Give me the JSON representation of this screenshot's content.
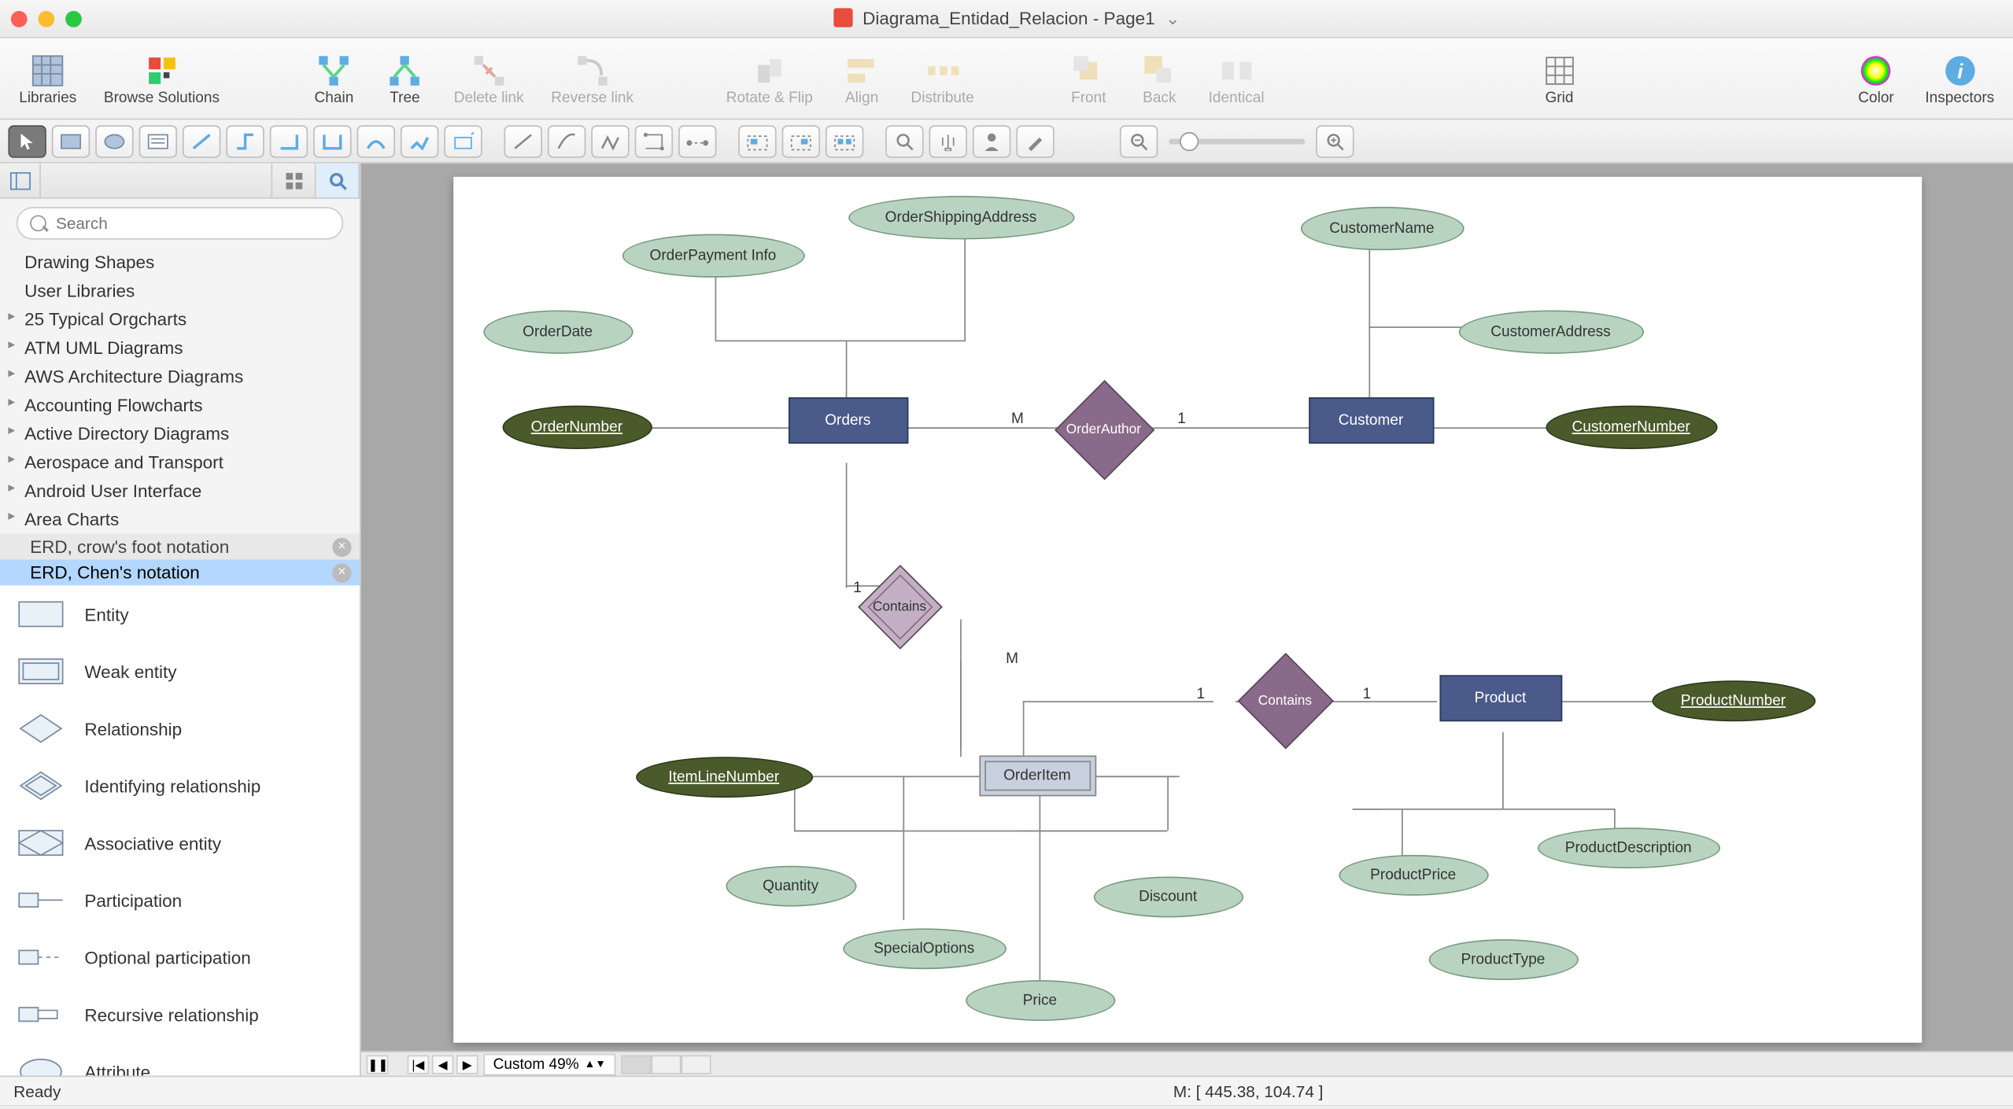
{
  "title": "Diagrama_Entidad_Relacion - Page1",
  "toolbar": {
    "libraries": "Libraries",
    "browse": "Browse Solutions",
    "chain": "Chain",
    "tree": "Tree",
    "delete_link": "Delete link",
    "reverse_link": "Reverse link",
    "rotate_flip": "Rotate & Flip",
    "align": "Align",
    "distribute": "Distribute",
    "front": "Front",
    "back": "Back",
    "identical": "Identical",
    "grid": "Grid",
    "color": "Color",
    "inspectors": "Inspectors"
  },
  "search_placeholder": "Search",
  "libraries": [
    {
      "label": "Drawing Shapes",
      "arrow": false
    },
    {
      "label": "User Libraries",
      "arrow": false
    },
    {
      "label": "25 Typical Orgcharts",
      "arrow": true
    },
    {
      "label": "ATM UML Diagrams",
      "arrow": true
    },
    {
      "label": "AWS Architecture Diagrams",
      "arrow": true
    },
    {
      "label": "Accounting Flowcharts",
      "arrow": true
    },
    {
      "label": "Active Directory Diagrams",
      "arrow": true
    },
    {
      "label": "Aerospace and Transport",
      "arrow": true
    },
    {
      "label": "Android User Interface",
      "arrow": true
    },
    {
      "label": "Area Charts",
      "arrow": true
    }
  ],
  "stencil_tabs": [
    {
      "label": "ERD, crow's foot notation",
      "active": false
    },
    {
      "label": "ERD, Chen's notation",
      "active": true
    }
  ],
  "stencils": [
    "Entity",
    "Weak entity",
    "Relationship",
    "Identifying relationship",
    "Associative entity",
    "Participation",
    "Optional participation",
    "Recursive relationship",
    "Attribute"
  ],
  "diagram": {
    "entities": {
      "orders": "Orders",
      "customer": "Customer",
      "product": "Product",
      "orderitem": "OrderItem"
    },
    "relationships": {
      "orderauthor": "OrderAuthor",
      "contains1": "Contains",
      "contains2": "Contains"
    },
    "attributes": {
      "orderdate": "OrderDate",
      "orderpayment": "OrderPayment Info",
      "ordershipping": "OrderShippingAddress",
      "customername": "CustomerName",
      "customeraddress": "CustomerAddress",
      "ordernumber": "OrderNumber",
      "customernumber": "CustomerNumber",
      "itemlinenumber": "ItemLineNumber",
      "productnumber": "ProductNumber",
      "quantity": "Quantity",
      "specialoptions": "SpecialOptions",
      "price": "Price",
      "discount": "Discount",
      "productprice": "ProductPrice",
      "productdescription": "ProductDescription",
      "producttype": "ProductType"
    },
    "cardinalities": {
      "c1m": "M",
      "c11": "1",
      "c21": "1",
      "c2m": "M",
      "c31": "1",
      "c311": "1"
    }
  },
  "zoom_label": "Custom 49%",
  "status": {
    "ready": "Ready",
    "coords": "M: [ 445.38, 104.74 ]"
  }
}
